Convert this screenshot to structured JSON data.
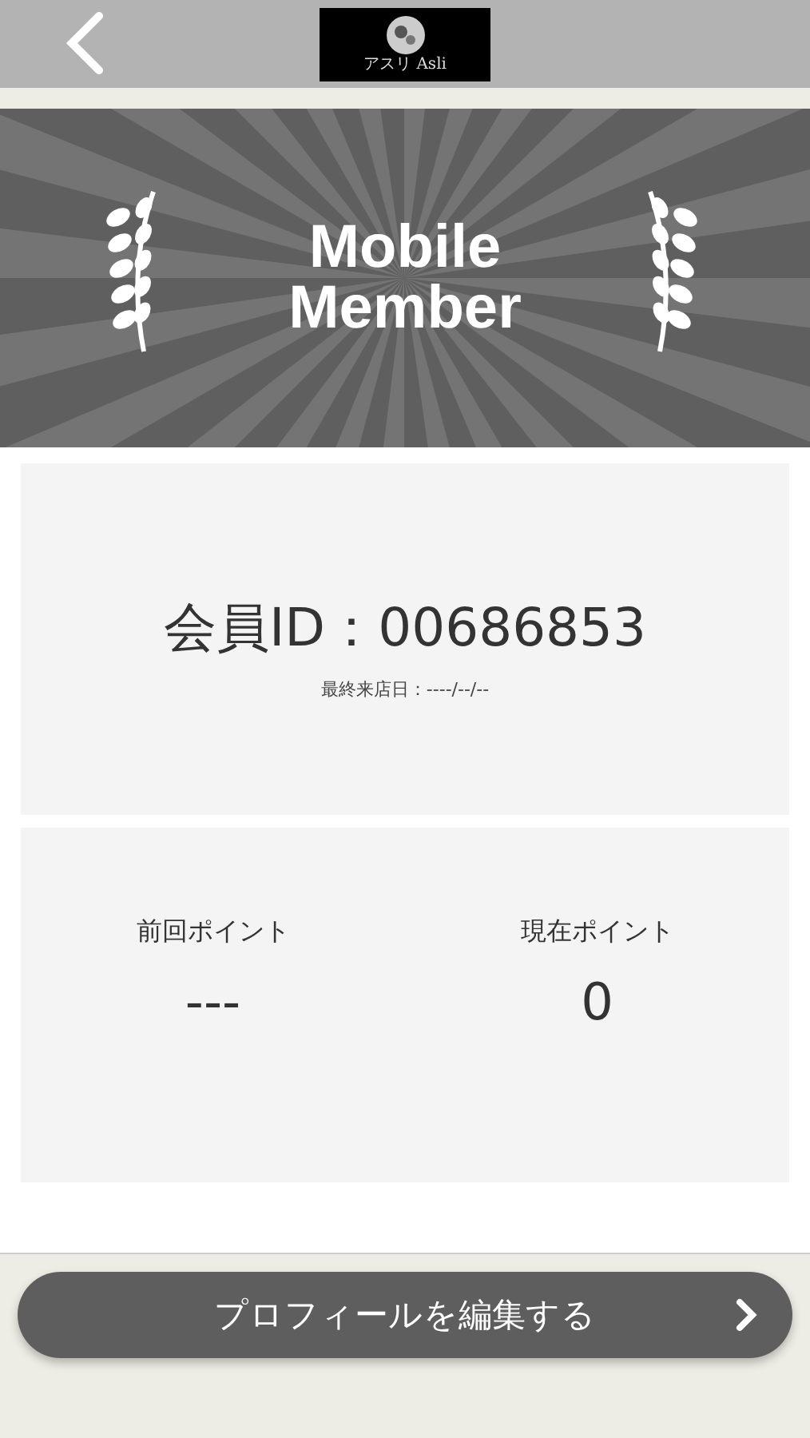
{
  "header": {
    "logo_text": "アスリ Asli"
  },
  "banner": {
    "title_lines": [
      "Mobile",
      "Member"
    ]
  },
  "member": {
    "id_label": "会員ID：00686853",
    "last_visit": "最終来店日：----/--/--"
  },
  "points": [
    {
      "label": "前回ポイント",
      "value": "---"
    },
    {
      "label": "現在ポイント",
      "value": "0"
    }
  ],
  "edit_button": {
    "label": "プロフィールを編集する"
  }
}
